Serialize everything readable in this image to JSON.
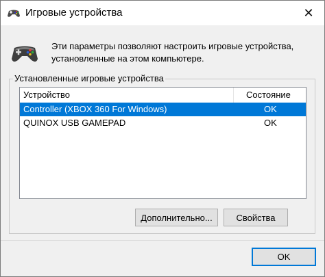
{
  "window": {
    "title": "Игровые устройства",
    "close_glyph": "✕"
  },
  "description": {
    "line1": "Эти параметры позволяют настроить игровые устройства,",
    "line2": "установленные на этом компьютере."
  },
  "devices": {
    "group_label": "Установленные игровые устройства",
    "columns": [
      "Устройство",
      "Состояние"
    ],
    "rows": [
      {
        "device": "Controller (XBOX 360 For Windows)",
        "status": "OK",
        "selected": true
      },
      {
        "device": "QUINOX USB GAMEPAD",
        "status": "OK",
        "selected": false
      }
    ]
  },
  "buttons": {
    "advanced": "Дополнительно...",
    "properties": "Свойства",
    "ok": "OK"
  },
  "colors": {
    "selection": "#0078d7",
    "default_button_border": "#0078d7"
  },
  "icons": {
    "title": "gamepad-icon",
    "description": "gamepad-icon"
  }
}
